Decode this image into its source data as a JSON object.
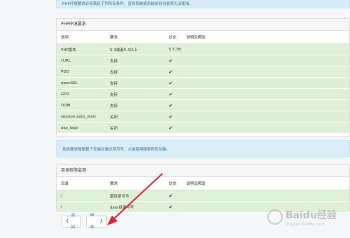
{
  "top_alert": "PHP环境要求必须满足下列所有条件，否则系统或系统部份功能将无法使用。",
  "env_panel": {
    "title": "PHP环境要求",
    "columns": [
      "选项",
      "要求",
      "状态",
      "说明及帮助"
    ],
    "rows": [
      {
        "option": "PHP版本",
        "requirement": "5.3或者5.3以上",
        "status": "5.5.38",
        "help": ""
      },
      {
        "option": "cURL",
        "requirement": "支持",
        "status": "✔",
        "help": ""
      },
      {
        "option": "PDO",
        "requirement": "支持",
        "status": "✔",
        "help": ""
      },
      {
        "option": "openSSL",
        "requirement": "支持",
        "status": "✔",
        "help": ""
      },
      {
        "option": "GD2",
        "requirement": "支持",
        "status": "✔",
        "help": ""
      },
      {
        "option": "DOM",
        "requirement": "支持",
        "status": "✔",
        "help": ""
      },
      {
        "option": "session.auto_start",
        "requirement": "关闭",
        "status": "✔",
        "help": ""
      },
      {
        "option": "asp_tags",
        "requirement": "关闭",
        "status": "✔",
        "help": ""
      }
    ]
  },
  "mid_alert": "系统要求微擎整个安装目录必须可写，才能使用微擎所有功能。",
  "dir_panel": {
    "title": "目录权限监测",
    "columns": [
      "目录",
      "要求",
      "状态",
      "说明及帮助"
    ],
    "rows": [
      {
        "dir": "/",
        "requirement": "整目录可写",
        "status": "✔",
        "help": ""
      },
      {
        "dir": "/",
        "requirement": "data目录可写",
        "status": "✔",
        "help": ""
      }
    ]
  },
  "buttons": {
    "back": "返回",
    "next": "继续"
  },
  "watermark": {
    "text": "Baidu经验",
    "sub": "jingyan.baidu.com"
  },
  "colors": {
    "alert_bg": "#d9edf7",
    "row_ok_bg": "#dff0d8",
    "link": "#337ab7",
    "arrow": "#e8202a"
  }
}
